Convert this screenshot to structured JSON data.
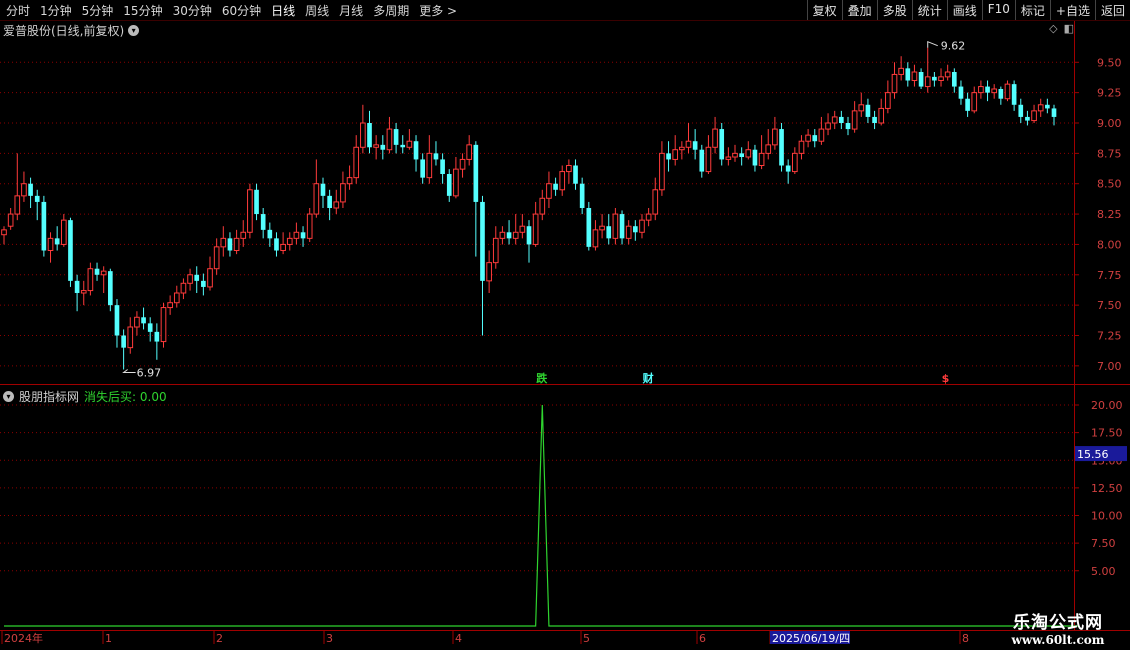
{
  "toolbar": {
    "periods": [
      "分时",
      "1分钟",
      "5分钟",
      "15分钟",
      "30分钟",
      "60分钟",
      "日线",
      "周线",
      "月线",
      "多周期",
      "更多 >"
    ],
    "active_period": "日线",
    "right_buttons": [
      "复权",
      "叠加",
      "多股",
      "统计",
      "画线",
      "F10",
      "标记",
      "+自选",
      "返回"
    ]
  },
  "stock": {
    "title": "爱普股份(日线,前复权)",
    "high_label": "9.62",
    "low_label": "6.97",
    "markers": [
      "跌",
      "财",
      "$"
    ]
  },
  "indicator": {
    "name": "股朋指标网",
    "param": "消失后买: 0.00",
    "current_value": "15.56"
  },
  "axis": {
    "price_ticks": [
      "9.50",
      "9.25",
      "9.00",
      "8.75",
      "8.50",
      "8.25",
      "8.00",
      "7.75",
      "7.50",
      "7.25",
      "7.00"
    ],
    "ind_ticks": [
      "20.00",
      "17.50",
      "15.00",
      "12.50",
      "10.00",
      "7.50",
      "5.00"
    ],
    "date_labels": [
      "2024年",
      "1",
      "2",
      "3",
      "4",
      "5",
      "6",
      "2025/06/19/四",
      "8"
    ]
  },
  "watermark": {
    "line1": "乐淘公式网",
    "line2": "www.60lt.com"
  },
  "colors": {
    "up": "#ff3b3b",
    "down": "#54ffff",
    "grid": "#8b0000",
    "indicator_line": "#2fd42f"
  },
  "chart_data": [
    {
      "type": "candlestick",
      "ylim": [
        6.9,
        9.7
      ],
      "ohlc": [
        [
          8.08,
          8.12,
          8.15,
          8.0
        ],
        [
          8.15,
          8.25,
          8.3,
          8.12
        ],
        [
          8.25,
          8.4,
          8.75,
          8.2
        ],
        [
          8.4,
          8.5,
          8.6,
          8.35
        ],
        [
          8.5,
          8.4,
          8.55,
          8.3
        ],
        [
          8.4,
          8.35,
          8.45,
          8.2
        ],
        [
          8.35,
          7.95,
          8.4,
          7.9
        ],
        [
          7.95,
          8.05,
          8.1,
          7.85
        ],
        [
          8.05,
          8.0,
          8.15,
          7.95
        ],
        [
          8.0,
          8.2,
          8.25,
          7.98
        ],
        [
          8.2,
          7.7,
          8.22,
          7.65
        ],
        [
          7.7,
          7.6,
          7.75,
          7.45
        ],
        [
          7.6,
          7.62,
          7.7,
          7.5
        ],
        [
          7.62,
          7.8,
          7.85,
          7.58
        ],
        [
          7.8,
          7.75,
          7.85,
          7.7
        ],
        [
          7.75,
          7.78,
          7.82,
          7.6
        ],
        [
          7.78,
          7.5,
          7.8,
          7.45
        ],
        [
          7.5,
          7.25,
          7.55,
          7.15
        ],
        [
          7.25,
          7.15,
          7.3,
          6.97
        ],
        [
          7.15,
          7.32,
          7.4,
          7.1
        ],
        [
          7.32,
          7.4,
          7.45,
          7.25
        ],
        [
          7.4,
          7.35,
          7.48,
          7.3
        ],
        [
          7.35,
          7.28,
          7.4,
          7.2
        ],
        [
          7.28,
          7.2,
          7.35,
          7.05
        ],
        [
          7.2,
          7.48,
          7.52,
          7.15
        ],
        [
          7.48,
          7.52,
          7.58,
          7.42
        ],
        [
          7.52,
          7.6,
          7.66,
          7.48
        ],
        [
          7.6,
          7.68,
          7.72,
          7.55
        ],
        [
          7.68,
          7.75,
          7.8,
          7.62
        ],
        [
          7.75,
          7.7,
          7.82,
          7.6
        ],
        [
          7.7,
          7.65,
          7.76,
          7.58
        ],
        [
          7.65,
          7.8,
          7.9,
          7.62
        ],
        [
          7.8,
          7.98,
          8.05,
          7.75
        ],
        [
          7.98,
          8.05,
          8.15,
          7.9
        ],
        [
          8.05,
          7.95,
          8.1,
          7.9
        ],
        [
          7.95,
          8.05,
          8.12,
          7.92
        ],
        [
          8.05,
          8.1,
          8.2,
          7.98
        ],
        [
          8.1,
          8.45,
          8.5,
          8.05
        ],
        [
          8.45,
          8.25,
          8.5,
          8.2
        ],
        [
          8.25,
          8.12,
          8.3,
          8.05
        ],
        [
          8.12,
          8.05,
          8.18,
          7.98
        ],
        [
          8.05,
          7.95,
          8.1,
          7.9
        ],
        [
          7.95,
          8.0,
          8.1,
          7.92
        ],
        [
          8.0,
          8.05,
          8.1,
          7.95
        ],
        [
          8.05,
          8.1,
          8.18,
          8.0
        ],
        [
          8.1,
          8.05,
          8.15,
          7.98
        ],
        [
          8.05,
          8.25,
          8.3,
          8.02
        ],
        [
          8.25,
          8.5,
          8.7,
          8.22
        ],
        [
          8.5,
          8.4,
          8.55,
          8.3
        ],
        [
          8.4,
          8.3,
          8.45,
          8.2
        ],
        [
          8.3,
          8.35,
          8.45,
          8.25
        ],
        [
          8.35,
          8.5,
          8.6,
          8.3
        ],
        [
          8.5,
          8.55,
          8.65,
          8.45
        ],
        [
          8.55,
          8.8,
          8.9,
          8.5
        ],
        [
          8.8,
          9.0,
          9.15,
          8.75
        ],
        [
          9.0,
          8.8,
          9.1,
          8.75
        ],
        [
          8.8,
          8.82,
          8.9,
          8.7
        ],
        [
          8.82,
          8.78,
          8.9,
          8.7
        ],
        [
          8.78,
          8.95,
          9.05,
          8.75
        ],
        [
          8.95,
          8.82,
          9.0,
          8.75
        ],
        [
          8.82,
          8.8,
          8.9,
          8.75
        ],
        [
          8.8,
          8.85,
          8.95,
          8.78
        ],
        [
          8.85,
          8.7,
          8.9,
          8.6
        ],
        [
          8.7,
          8.55,
          8.75,
          8.5
        ],
        [
          8.55,
          8.75,
          8.9,
          8.5
        ],
        [
          8.75,
          8.7,
          8.85,
          8.65
        ],
        [
          8.7,
          8.58,
          8.75,
          8.5
        ],
        [
          8.58,
          8.4,
          8.62,
          8.35
        ],
        [
          8.4,
          8.62,
          8.72,
          8.38
        ],
        [
          8.62,
          8.7,
          8.75,
          8.55
        ],
        [
          8.7,
          8.82,
          8.9,
          8.65
        ],
        [
          8.82,
          8.35,
          8.85,
          7.9
        ],
        [
          8.35,
          7.7,
          8.4,
          7.25
        ],
        [
          7.7,
          7.85,
          7.95,
          7.6
        ],
        [
          7.85,
          8.05,
          8.15,
          7.8
        ],
        [
          8.05,
          8.1,
          8.15,
          8.0
        ],
        [
          8.1,
          8.05,
          8.2,
          8.0
        ],
        [
          8.05,
          8.1,
          8.25,
          8.0
        ],
        [
          8.1,
          8.15,
          8.25,
          8.05
        ],
        [
          8.15,
          8.0,
          8.2,
          7.85
        ],
        [
          8.0,
          8.25,
          8.35,
          7.98
        ],
        [
          8.25,
          8.38,
          8.45,
          8.2
        ],
        [
          8.38,
          8.5,
          8.6,
          8.3
        ],
        [
          8.5,
          8.45,
          8.55,
          8.4
        ],
        [
          8.45,
          8.6,
          8.65,
          8.4
        ],
        [
          8.6,
          8.65,
          8.7,
          8.5
        ],
        [
          8.65,
          8.5,
          8.7,
          8.45
        ],
        [
          8.5,
          8.3,
          8.55,
          8.25
        ],
        [
          8.3,
          7.98,
          8.35,
          7.95
        ],
        [
          7.98,
          8.12,
          8.2,
          7.95
        ],
        [
          8.12,
          8.15,
          8.25,
          8.05
        ],
        [
          8.15,
          8.05,
          8.25,
          8.0
        ],
        [
          8.05,
          8.25,
          8.3,
          8.0
        ],
        [
          8.25,
          8.05,
          8.28,
          8.0
        ],
        [
          8.05,
          8.15,
          8.2,
          8.0
        ],
        [
          8.15,
          8.1,
          8.2,
          8.03
        ],
        [
          8.1,
          8.2,
          8.25,
          8.05
        ],
        [
          8.2,
          8.25,
          8.3,
          8.15
        ],
        [
          8.25,
          8.45,
          8.55,
          8.2
        ],
        [
          8.45,
          8.75,
          8.85,
          8.4
        ],
        [
          8.75,
          8.7,
          8.85,
          8.6
        ],
        [
          8.7,
          8.78,
          8.9,
          8.65
        ],
        [
          8.78,
          8.8,
          8.85,
          8.7
        ],
        [
          8.8,
          8.85,
          9.0,
          8.75
        ],
        [
          8.85,
          8.78,
          8.95,
          8.7
        ],
        [
          8.78,
          8.6,
          8.82,
          8.55
        ],
        [
          8.6,
          8.8,
          8.9,
          8.58
        ],
        [
          8.8,
          8.95,
          9.05,
          8.75
        ],
        [
          8.95,
          8.7,
          9.0,
          8.65
        ],
        [
          8.7,
          8.72,
          8.8,
          8.65
        ],
        [
          8.72,
          8.75,
          8.82,
          8.68
        ],
        [
          8.75,
          8.72,
          8.8,
          8.65
        ],
        [
          8.72,
          8.78,
          8.85,
          8.7
        ],
        [
          8.78,
          8.65,
          8.82,
          8.6
        ],
        [
          8.65,
          8.75,
          8.9,
          8.62
        ],
        [
          8.75,
          8.82,
          8.95,
          8.7
        ],
        [
          8.82,
          8.95,
          9.05,
          8.78
        ],
        [
          8.95,
          8.65,
          9.0,
          8.6
        ],
        [
          8.65,
          8.6,
          8.7,
          8.5
        ],
        [
          8.6,
          8.75,
          8.8,
          8.58
        ],
        [
          8.75,
          8.85,
          8.9,
          8.7
        ],
        [
          8.85,
          8.9,
          8.95,
          8.8
        ],
        [
          8.9,
          8.85,
          8.95,
          8.8
        ],
        [
          8.85,
          8.95,
          9.05,
          8.82
        ],
        [
          8.95,
          9.0,
          9.08,
          8.9
        ],
        [
          9.0,
          9.05,
          9.1,
          8.95
        ],
        [
          9.05,
          9.0,
          9.1,
          8.95
        ],
        [
          9.0,
          8.95,
          9.05,
          8.9
        ],
        [
          8.95,
          9.1,
          9.18,
          8.92
        ],
        [
          9.1,
          9.15,
          9.25,
          9.05
        ],
        [
          9.15,
          9.05,
          9.2,
          9.0
        ],
        [
          9.05,
          9.0,
          9.1,
          8.95
        ],
        [
          9.0,
          9.12,
          9.2,
          8.98
        ],
        [
          9.12,
          9.25,
          9.35,
          9.08
        ],
        [
          9.25,
          9.4,
          9.5,
          9.2
        ],
        [
          9.4,
          9.45,
          9.55,
          9.35
        ],
        [
          9.45,
          9.35,
          9.5,
          9.3
        ],
        [
          9.35,
          9.42,
          9.48,
          9.3
        ],
        [
          9.42,
          9.3,
          9.45,
          9.28
        ],
        [
          9.3,
          9.38,
          9.62,
          9.25
        ],
        [
          9.38,
          9.35,
          9.42,
          9.3
        ],
        [
          9.35,
          9.38,
          9.45,
          9.3
        ],
        [
          9.38,
          9.42,
          9.48,
          9.35
        ],
        [
          9.42,
          9.3,
          9.45,
          9.25
        ],
        [
          9.3,
          9.2,
          9.35,
          9.15
        ],
        [
          9.2,
          9.1,
          9.25,
          9.05
        ],
        [
          9.1,
          9.25,
          9.3,
          9.08
        ],
        [
          9.25,
          9.3,
          9.35,
          9.2
        ],
        [
          9.3,
          9.25,
          9.35,
          9.18
        ],
        [
          9.25,
          9.28,
          9.32,
          9.2
        ],
        [
          9.28,
          9.2,
          9.3,
          9.15
        ],
        [
          9.2,
          9.32,
          9.35,
          9.18
        ],
        [
          9.32,
          9.15,
          9.35,
          9.1
        ],
        [
          9.15,
          9.05,
          9.2,
          9.0
        ],
        [
          9.05,
          9.02,
          9.1,
          8.98
        ],
        [
          9.02,
          9.1,
          9.15,
          9.0
        ],
        [
          9.1,
          9.15,
          9.2,
          9.05
        ],
        [
          9.15,
          9.12,
          9.2,
          9.08
        ],
        [
          9.12,
          9.05,
          9.15,
          8.98
        ]
      ]
    },
    {
      "type": "line",
      "name": "消失后买",
      "ylim": [
        0,
        20
      ],
      "spike_day": 81,
      "spike_value": 20.0,
      "base_value": 0.0
    }
  ]
}
